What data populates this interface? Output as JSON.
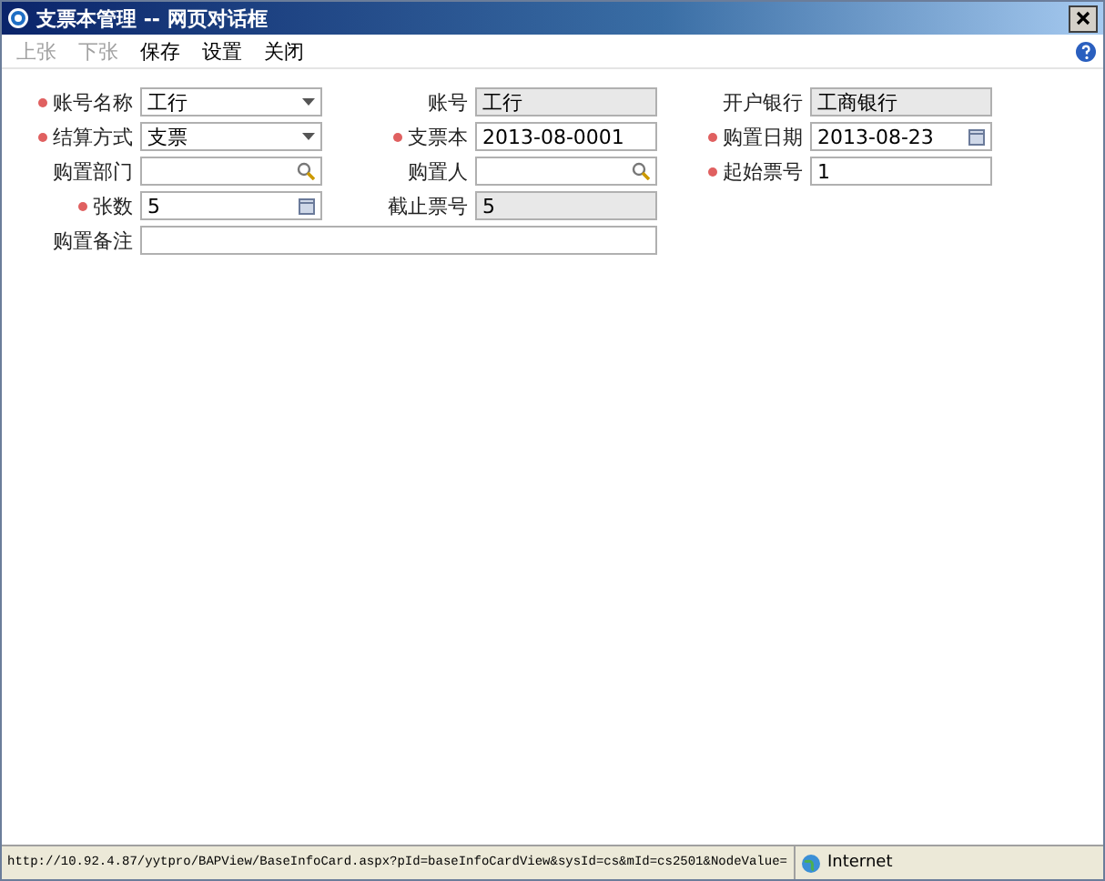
{
  "window": {
    "title": "支票本管理 -- 网页对话框"
  },
  "toolbar": [
    {
      "label": "上张",
      "disabled": true
    },
    {
      "label": "下张",
      "disabled": true
    },
    {
      "label": "保存",
      "disabled": false
    },
    {
      "label": "设置",
      "disabled": false
    },
    {
      "label": "关闭",
      "disabled": false
    }
  ],
  "form": {
    "rows": [
      [
        {
          "label": "账号名称",
          "required": true,
          "kind": "dropdown",
          "value": "工行"
        },
        {
          "label": "账号",
          "required": false,
          "kind": "readonly",
          "value": "工行"
        },
        {
          "label": "开户银行",
          "required": false,
          "kind": "readonly",
          "value": "工商银行"
        }
      ],
      [
        {
          "label": "结算方式",
          "required": true,
          "kind": "dropdown",
          "value": "支票"
        },
        {
          "label": "支票本",
          "required": true,
          "kind": "text",
          "value": "2013-08-0001"
        },
        {
          "label": "购置日期",
          "required": true,
          "kind": "date",
          "value": "2013-08-23"
        }
      ],
      [
        {
          "label": "购置部门",
          "required": false,
          "kind": "search"
        },
        {
          "label": "购置人",
          "required": false,
          "kind": "search"
        },
        {
          "label": "起始票号",
          "required": true,
          "kind": "text",
          "value": "1"
        }
      ],
      [
        {
          "label": "张数",
          "required": true,
          "kind": "number",
          "value": "5"
        },
        {
          "label": "截止票号",
          "required": false,
          "kind": "readonly",
          "value": "5"
        }
      ],
      [
        {
          "label": "购置备注",
          "required": false,
          "kind": "wide"
        }
      ]
    ]
  },
  "status_bar": {
    "url": "http://10.92.4.87/yytpro/BAPView/BaseInfoCard.aspx?pId=baseInfoCardView&sysId=cs&mId=cs2501&NodeValue=",
    "zone": "Internet"
  }
}
